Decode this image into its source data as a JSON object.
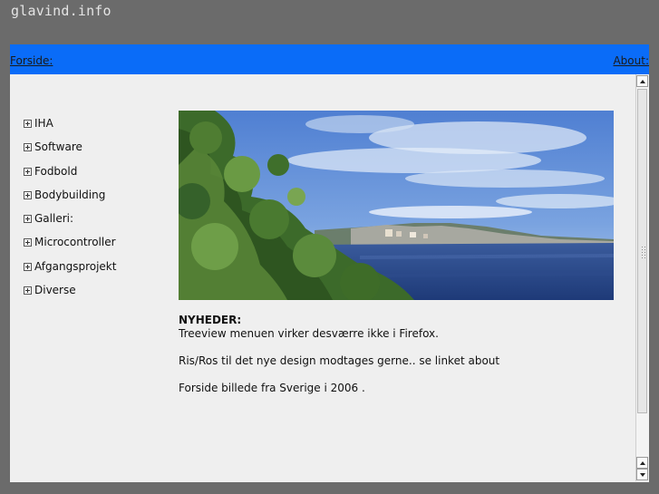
{
  "site": {
    "title": "glavind.info"
  },
  "nav": {
    "forside": "Forside:",
    "about": "About:"
  },
  "menu": {
    "items": [
      {
        "label": "IHA"
      },
      {
        "label": "Software"
      },
      {
        "label": "Fodbold"
      },
      {
        "label": "Bodybuilding"
      },
      {
        "label": "Galleri:"
      },
      {
        "label": "Microcontroller"
      },
      {
        "label": "Afgangsprojekt"
      },
      {
        "label": "Diverse"
      }
    ]
  },
  "news": {
    "heading": "NYHEDER:",
    "line1": "Treeview menuen virker desværre ikke i Firefox.",
    "line2": "Ris/Ros til det nye design modtages gerne.. se linket about",
    "line3": "Forside billede fra Sverige i 2006 ."
  },
  "colors": {
    "page_bg": "#6b6b6b",
    "nav_bg": "#0a6cf8",
    "content_bg": "#efefef"
  }
}
